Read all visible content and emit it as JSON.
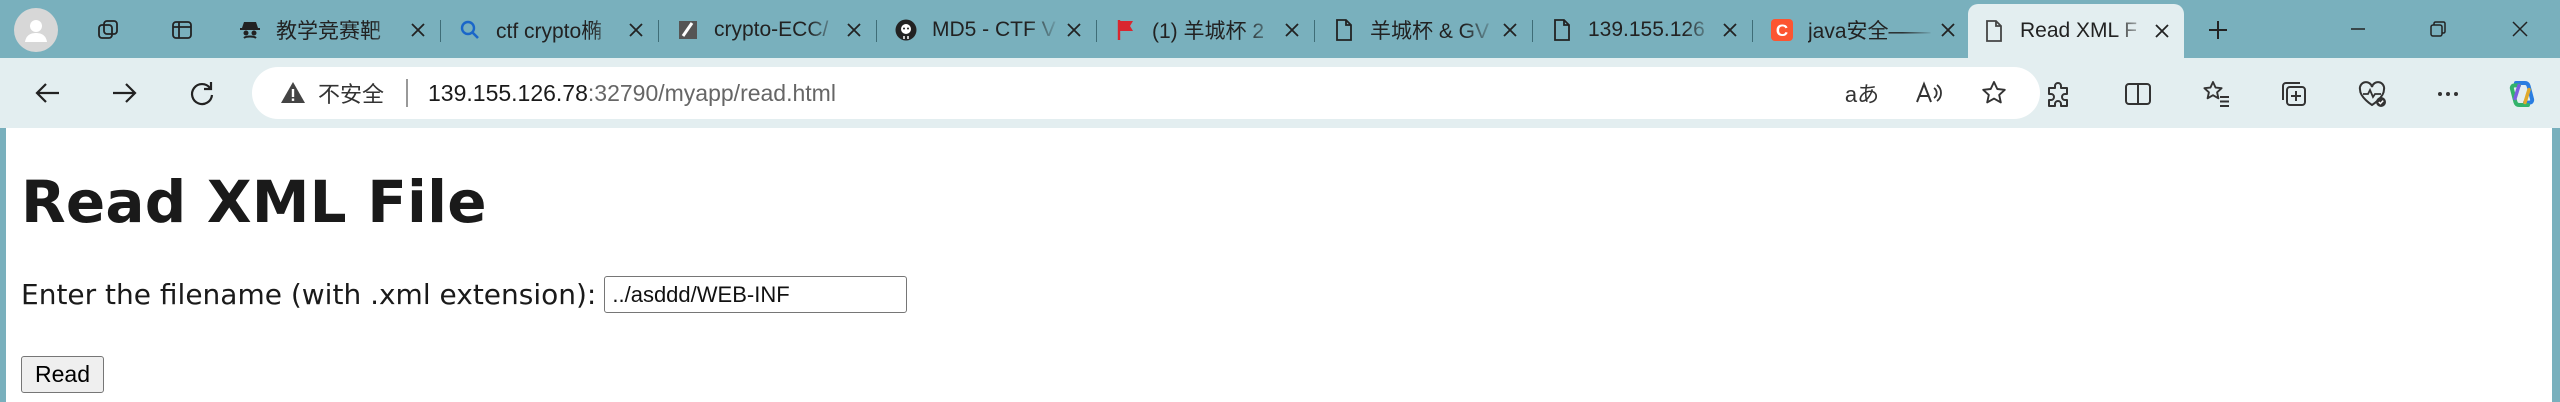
{
  "browser": {
    "tabs": [
      {
        "title": "教学竞赛靶",
        "icon": "spy-agent-icon"
      },
      {
        "title": "ctf crypto椭",
        "icon": "search-icon"
      },
      {
        "title": "crypto-ECC/",
        "icon": "slash-doc-icon"
      },
      {
        "title": "MD5 - CTF V",
        "icon": "github-icon"
      },
      {
        "title": "(1) 羊城杯 2",
        "icon": "red-flag-icon"
      },
      {
        "title": "羊城杯 & GV",
        "icon": "page-icon"
      },
      {
        "title": "139.155.126",
        "icon": "page-icon"
      },
      {
        "title": "java安全——",
        "icon": "csdn-icon"
      },
      {
        "title": "Read XML F",
        "icon": "page-icon"
      }
    ],
    "active_tab_index": 8,
    "address": {
      "security_label": "不安全",
      "host": "139.155.126.78",
      "rest": ":32790/myapp/read.html"
    },
    "reader_icon_text": "aあ",
    "accent": "#79b0bd"
  },
  "page": {
    "heading": "Read XML File",
    "prompt_label": "Enter the filename (with .xml extension):",
    "filename_value": "../asddd/WEB-INF",
    "read_button": "Read"
  }
}
